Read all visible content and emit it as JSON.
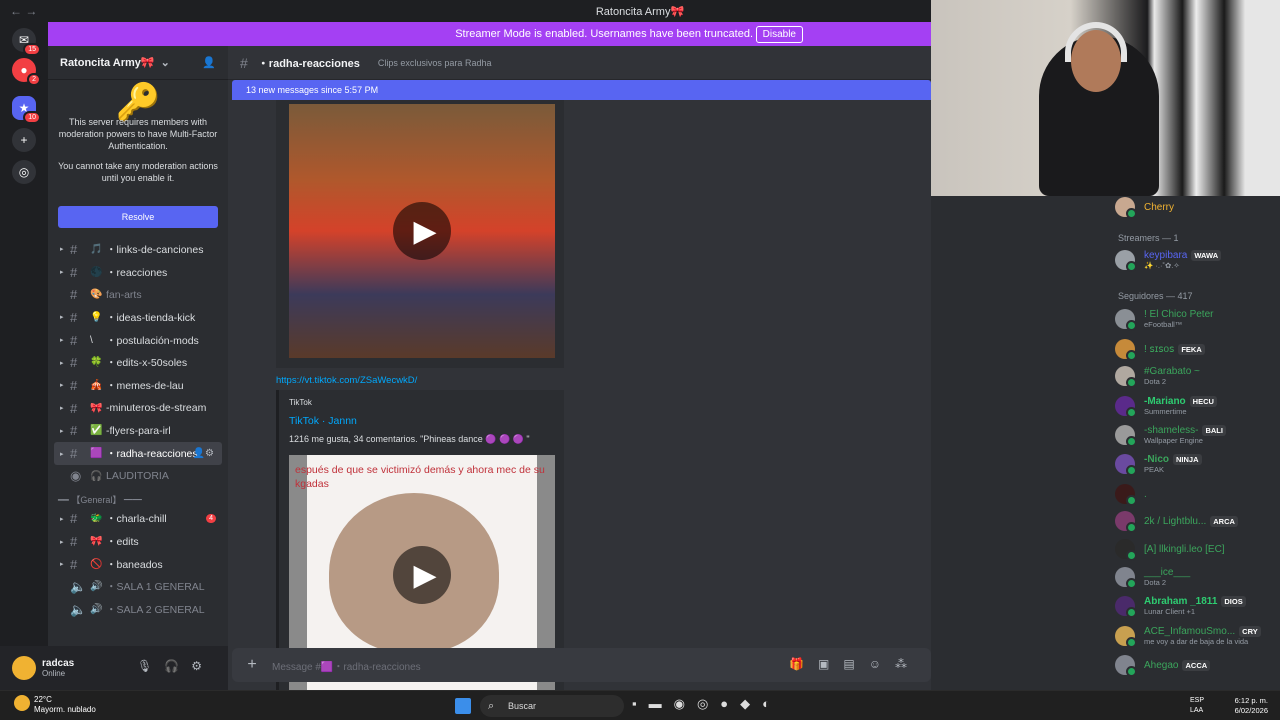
{
  "window": {
    "title": "Ratoncita Army🎀"
  },
  "banner": {
    "message": "Streamer Mode is enabled. Usernames have been truncated.",
    "disable_label": "Disable"
  },
  "servers": {
    "items": [
      {
        "badge": "15"
      },
      {
        "badge": "2"
      },
      {
        "badge": "10"
      }
    ]
  },
  "sidebar": {
    "server_name": "Ratoncita Army🎀",
    "mfa_text_1": "This server requires members with moderation powers to have Multi-Factor Authentication.",
    "mfa_text_2": "You cannot take any moderation actions until you enable it.",
    "resolve_label": "Resolve",
    "channels": [
      {
        "emoji": "🎵",
        "name": "・links-de-canciones"
      },
      {
        "emoji": "🌑",
        "name": "・reacciones"
      },
      {
        "emoji": "🎨",
        "name": "fan-arts"
      },
      {
        "emoji": "💡",
        "name": "・ideas-tienda-kick"
      },
      {
        "emoji": "\\",
        "name": "・postulación-mods"
      },
      {
        "emoji": "🍀",
        "name": "・edits-x-50soles"
      },
      {
        "emoji": "🎪",
        "name": "・memes-de-lau"
      },
      {
        "emoji": "🎀",
        "name": "-minuteros-de-stream"
      },
      {
        "emoji": "✅",
        "name": "-flyers-para-irl"
      },
      {
        "emoji": "🟪",
        "name": "・radha-reacciones"
      },
      {
        "emoji": "🎧",
        "name": "LAUDITORIA"
      }
    ],
    "category_general": "━━ 【General】 ━━",
    "general_channels": [
      {
        "emoji": "🐲",
        "name": "・charla-chill",
        "count": "4"
      },
      {
        "emoji": "🎀",
        "name": "・edits"
      },
      {
        "emoji": "🚫",
        "name": "・baneados"
      },
      {
        "emoji": "🔊",
        "name": "・SALA 1 GENERAL"
      },
      {
        "emoji": "🔊",
        "name": "・SALA 2 GENERAL"
      }
    ]
  },
  "user": {
    "name": "radcas",
    "status": "Online"
  },
  "chat": {
    "channel_name": "・radha-reacciones",
    "topic": "Clips exclusivos para Radha",
    "new_messages": "13 new messages since 5:57 PM",
    "link": "https://vt.tiktok.com/ZSaWecwkD/",
    "embed_provider": "TikTok",
    "embed_title": "TikTok · Jannn",
    "embed_description": "1216 me gusta, 34 comentarios. \"Phineas dance 🟣 🟣 🟣 \"",
    "video_caption": "espués de que se victimizó demás y ahora mec de su kgadas",
    "composer_placeholder": "Message #🟪・radha-reacciones"
  },
  "members": {
    "top": {
      "name": "Cherry"
    },
    "group_streamers": "Streamers — 1",
    "streamers": [
      {
        "name": "keypibara",
        "tag": "WAWA",
        "sub": "✨ ·.·˚✿.✧"
      }
    ],
    "group_followers": "Seguidores — 417",
    "followers": [
      {
        "name": "! El Chico Peter",
        "sub": "eFootball™",
        "color": "#3ba55c"
      },
      {
        "name": "! ꜱɪꜱᴏꜱ",
        "tag": "FEKA",
        "sub": "",
        "color": "#3ba55c"
      },
      {
        "name": "#Garabato ~",
        "sub": "Dota 2",
        "color": "#3ba55c"
      },
      {
        "name": "-Mariano",
        "tag": "HECU",
        "sub": "Summertime",
        "color": "#2ecc71"
      },
      {
        "name": "-shameless-",
        "tag": "BALI",
        "sub": "Wallpaper Engine",
        "color": "#3ba55c"
      },
      {
        "name": "-Nico",
        "tag": "NINJA",
        "sub": "PEAK",
        "color": "#3ba55c"
      },
      {
        "name": ".",
        "sub": "",
        "color": "#3ba55c"
      },
      {
        "name": "2k / Lightblu...",
        "tag": "ARCA",
        "sub": "",
        "color": "#3ba55c"
      },
      {
        "name": "[A] llkingli.leo [EC]",
        "sub": "",
        "color": "#3ba55c"
      },
      {
        "name": "___ice___",
        "sub": "Dota 2",
        "color": "#3ba55c"
      },
      {
        "name": "Abraham _1811",
        "tag": "DIOS",
        "sub": "Lunar Client +1",
        "color": "#2ecc71"
      },
      {
        "name": "ACE_InfamouSmo...",
        "tag": "CRY",
        "sub": "me voy a dar de baja de la vida",
        "color": "#3ba55c"
      },
      {
        "name": "Ahegao",
        "tag": "ACCA",
        "sub": "",
        "color": "#3ba55c"
      }
    ]
  },
  "taskbar": {
    "temp": "22°C",
    "weather": "Mayorm. nublado",
    "search_label": "Buscar",
    "lang_1": "ESP",
    "lang_2": "LAA",
    "time": "6:12 p. m.",
    "date": "6/02/2026"
  }
}
